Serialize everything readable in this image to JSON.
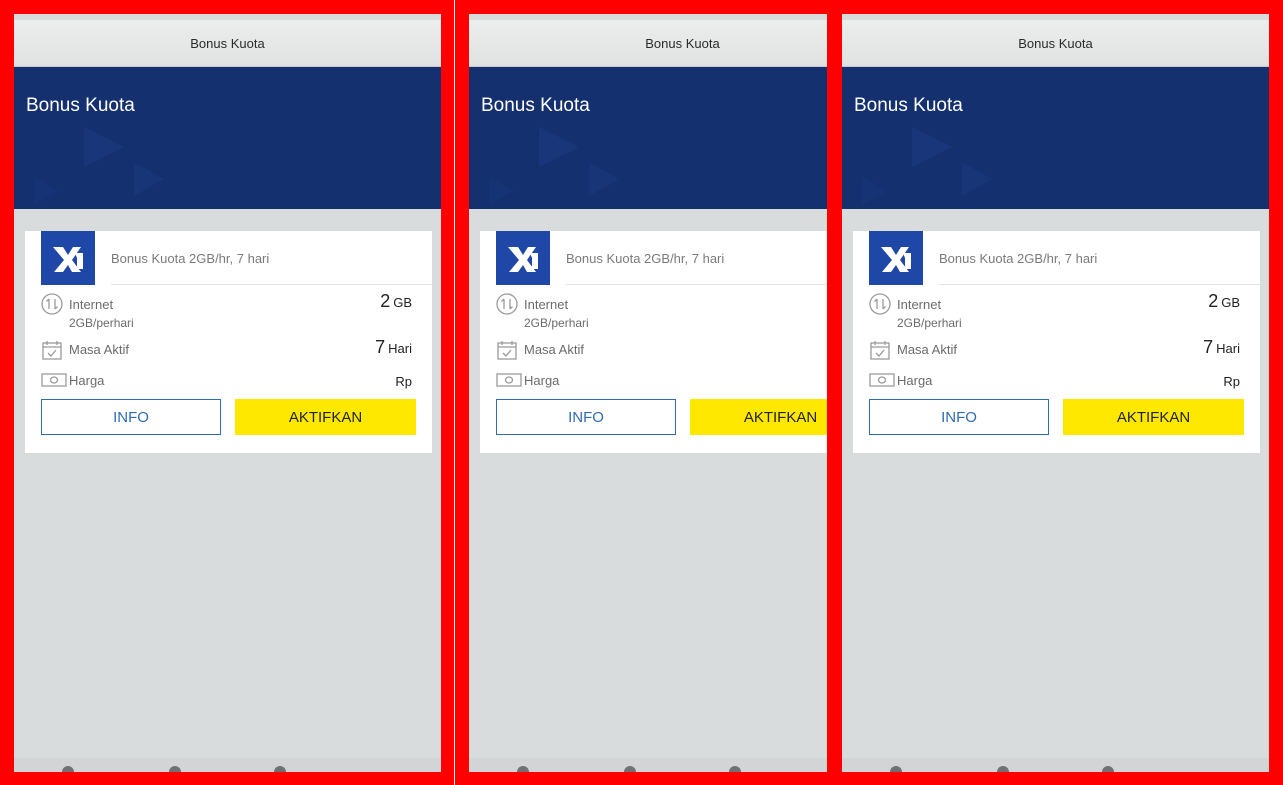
{
  "colors": {
    "frame": "#ff0000",
    "hero_bg": "#14306f",
    "logo_bg": "#1f47a8",
    "info_border": "#2e6bb5",
    "activate_bg": "#ffe800",
    "screen_bg": "#d9dcdd"
  },
  "panels": [
    {
      "topbar_title": "Bonus Kuota",
      "hero_title": "Bonus Kuota",
      "package": {
        "logo": "xl-logo",
        "name": "Bonus Kuota 2GB/hr, 7 hari",
        "internet_label": "Internet",
        "internet_sub": "2GB/perhari",
        "internet_value": "2",
        "internet_unit": "GB",
        "masa_label": "Masa Aktif",
        "masa_value": "7",
        "masa_unit": "Hari",
        "harga_label": "Harga",
        "harga_value": "Rp",
        "info_button": "INFO",
        "activate_button": "AKTIFKAN"
      }
    },
    {
      "topbar_title": "Bonus Kuota",
      "hero_title": "Bonus Kuota",
      "package": {
        "logo": "xl-logo",
        "name": "Bonus Kuota 2GB/hr, 7 hari",
        "internet_label": "Internet",
        "internet_sub": "2GB/perhari",
        "internet_value": "",
        "internet_unit": "",
        "masa_label": "Masa Aktif",
        "masa_value": "",
        "masa_unit": "",
        "harga_label": "Harga",
        "harga_value": "",
        "info_button": "INFO",
        "activate_button": "AKTIFKAN"
      }
    },
    {
      "topbar_title": "Bonus Kuota",
      "hero_title": "Bonus Kuota",
      "package": {
        "logo": "xl-logo",
        "name": "Bonus Kuota 2GB/hr, 7 hari",
        "internet_label": "Internet",
        "internet_sub": "2GB/perhari",
        "internet_value": "2",
        "internet_unit": "GB",
        "masa_label": "Masa Aktif",
        "masa_value": "7",
        "masa_unit": "Hari",
        "harga_label": "Harga",
        "harga_value": "Rp",
        "info_button": "INFO",
        "activate_button": "AKTIFKAN"
      }
    }
  ]
}
